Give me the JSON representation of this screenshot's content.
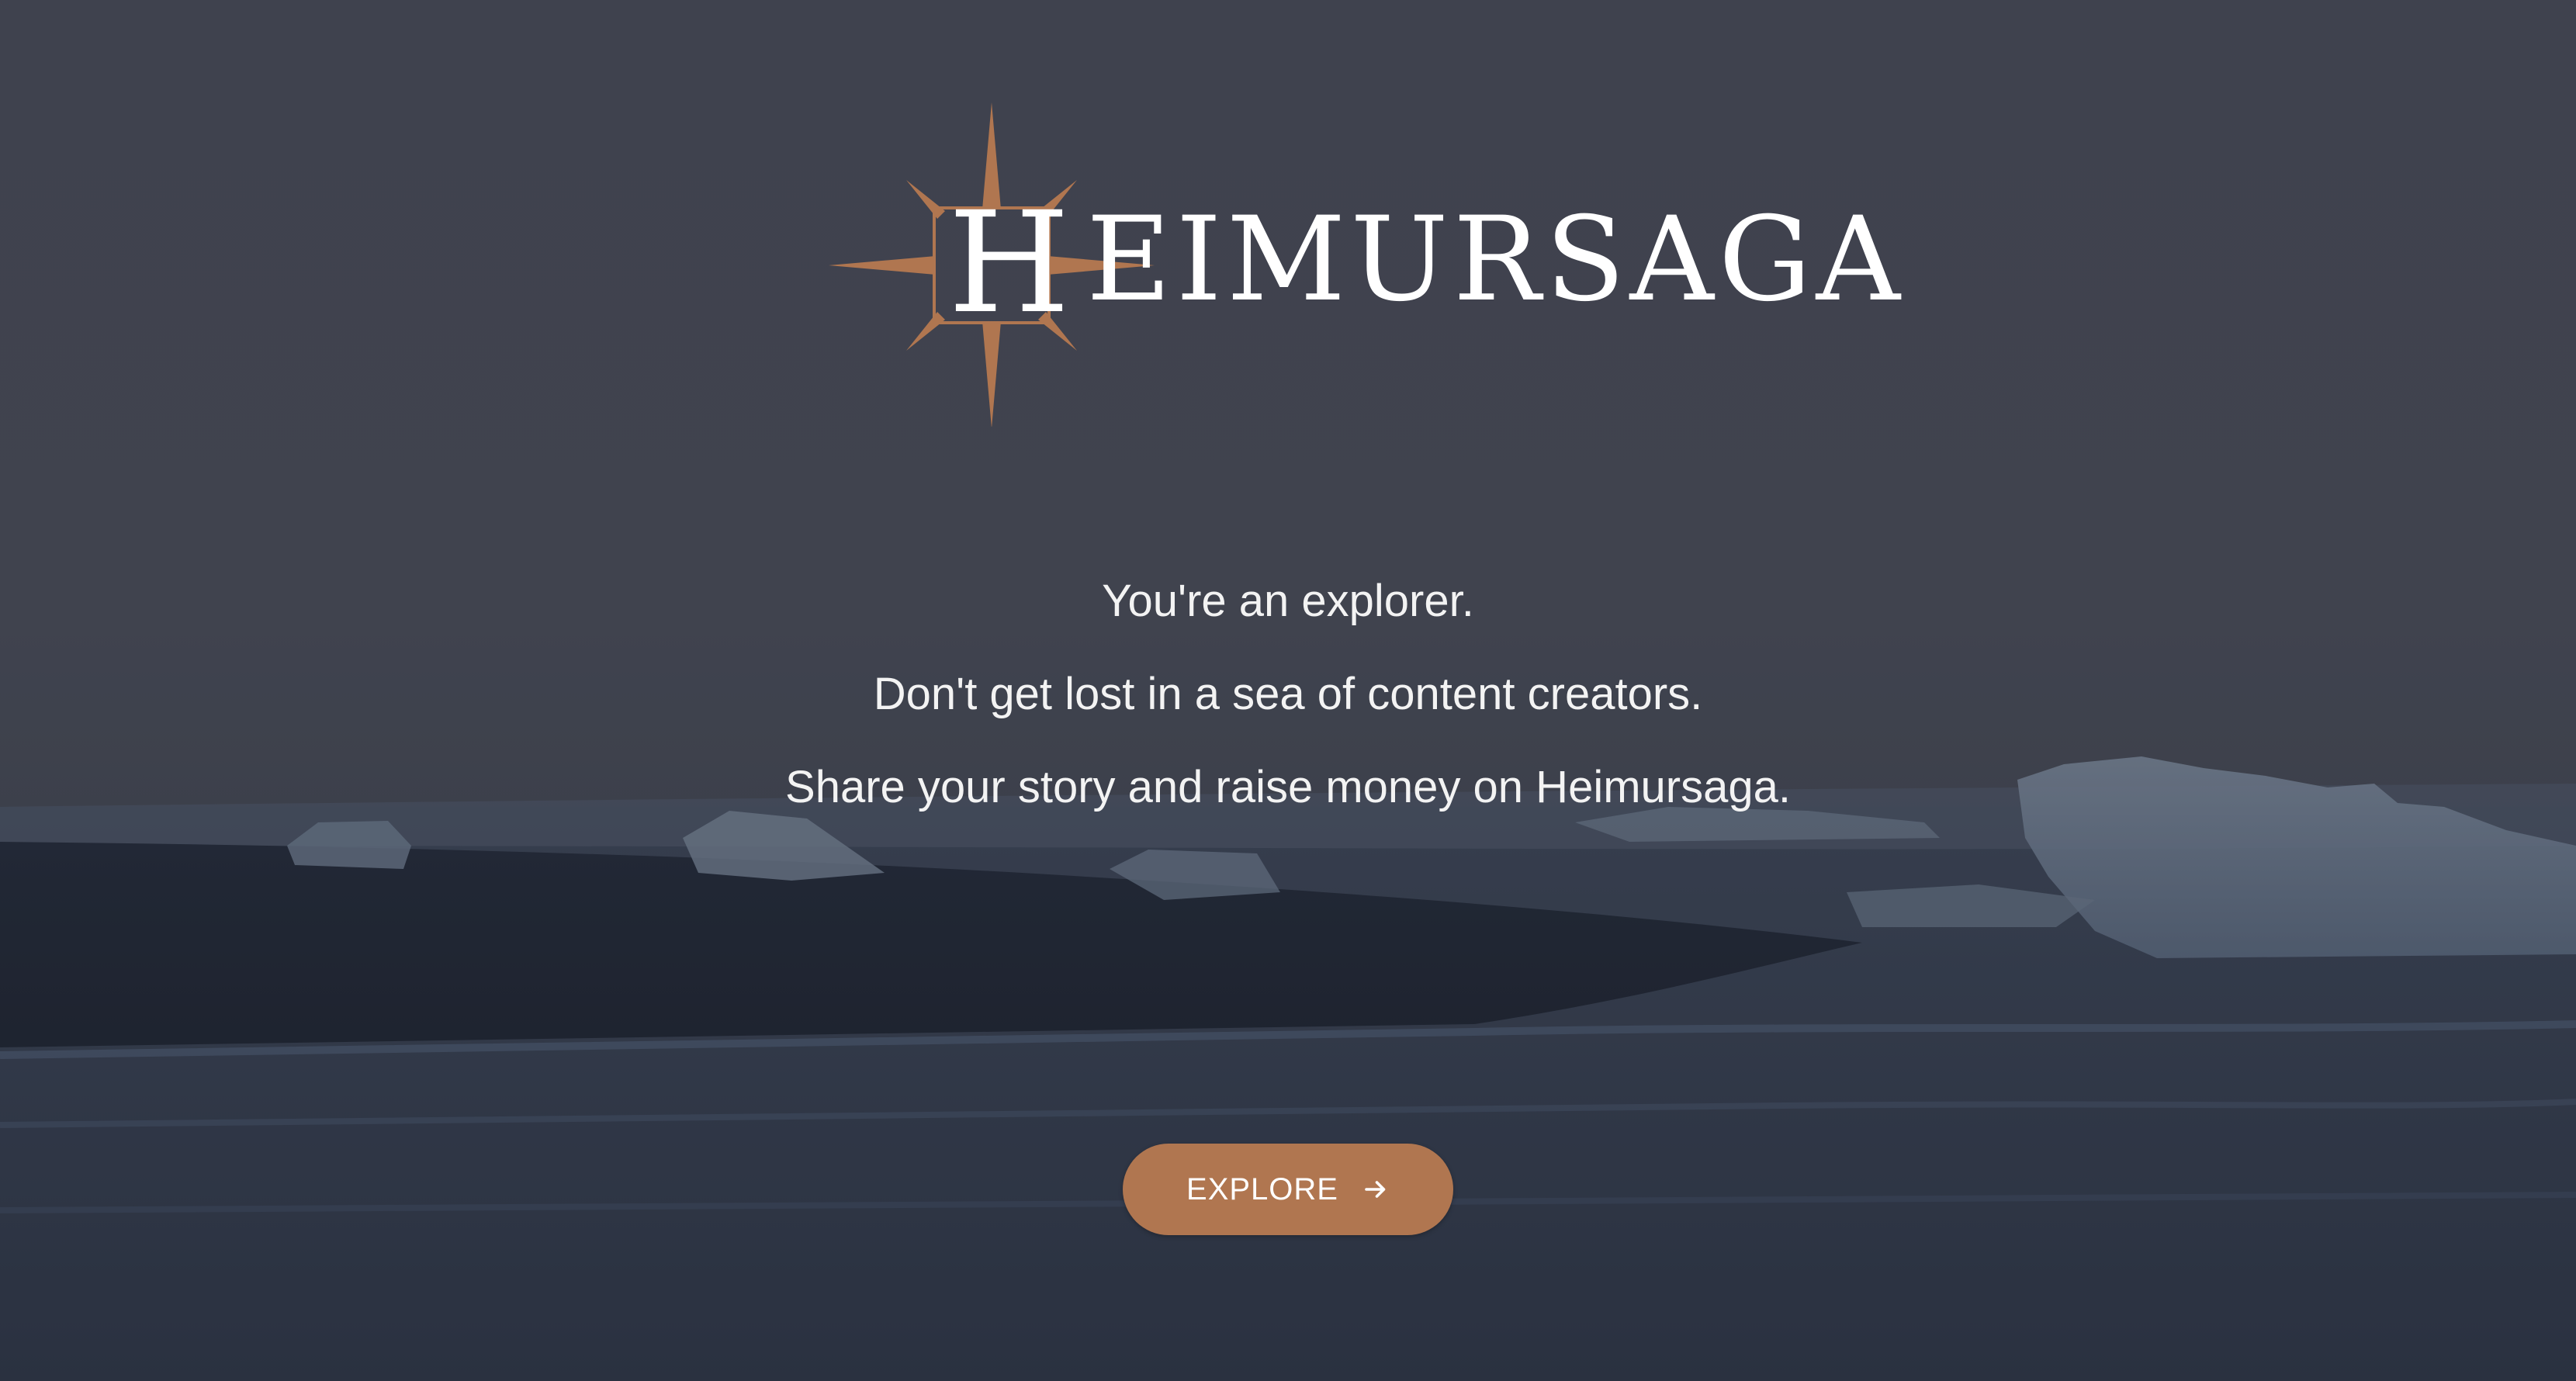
{
  "brand": {
    "name": "HEIMURSAGA",
    "initial": "H",
    "wordmark_rest": "EIMURSAGA",
    "accent_color": "#b07650"
  },
  "hero": {
    "lines": [
      "You're an explorer.",
      "Don't get lost in a sea of content creators.",
      "Share your story and raise money on Heimursaga."
    ]
  },
  "cta": {
    "label": "EXPLORE",
    "icon": "arrow-right-icon"
  },
  "background": {
    "description_icon": "ocean-ice-beach-background"
  }
}
